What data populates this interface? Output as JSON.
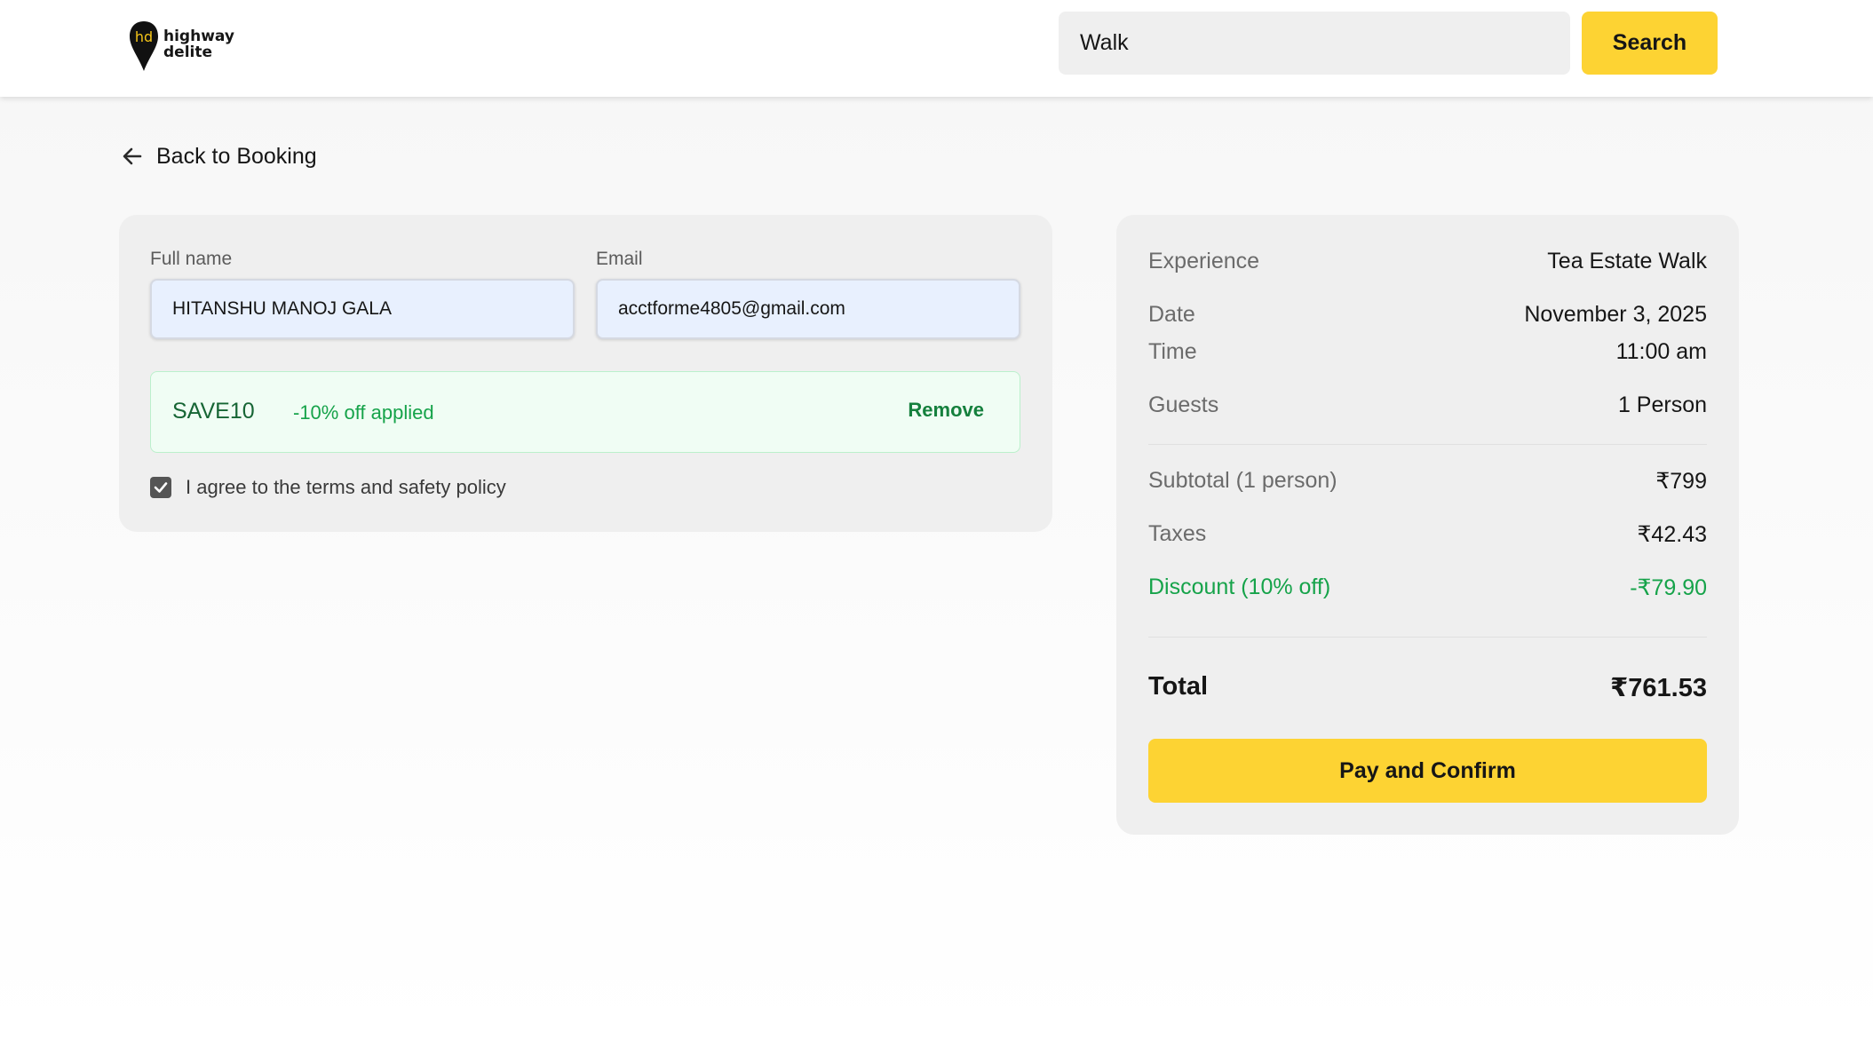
{
  "header": {
    "logo_line1": "highway",
    "logo_line2": "delite",
    "search_value": "Walk",
    "search_button": "Search"
  },
  "back_link": "Back to Booking",
  "form": {
    "full_name_label": "Full name",
    "full_name_value": "HITANSHU MANOJ GALA",
    "email_label": "Email",
    "email_value": "acctforme4805@gmail.com",
    "promo_code": "SAVE10",
    "promo_message": "-10% off applied",
    "remove_label": "Remove",
    "agree_text": "I agree to the terms and safety policy",
    "agree_checked": true
  },
  "summary": {
    "experience_label": "Experience",
    "experience_value": "Tea Estate Walk",
    "date_label": "Date",
    "date_value": "November 3, 2025",
    "time_label": "Time",
    "time_value": "11:00 am",
    "guests_label": "Guests",
    "guests_value": "1 Person",
    "subtotal_label": "Subtotal (1 person)",
    "subtotal_value": "₹799",
    "taxes_label": "Taxes",
    "taxes_value": "₹42.43",
    "discount_label": "Discount (10% off)",
    "discount_value": "-₹79.90",
    "total_label": "Total",
    "total_value": "₹761.53",
    "pay_button": "Pay and Confirm"
  },
  "colors": {
    "accent": "#fdd333",
    "discount_green": "#16a34a",
    "card_bg": "#efefef"
  },
  "icons": [
    "map-pin-logo-icon",
    "arrow-left-icon",
    "check-icon"
  ]
}
